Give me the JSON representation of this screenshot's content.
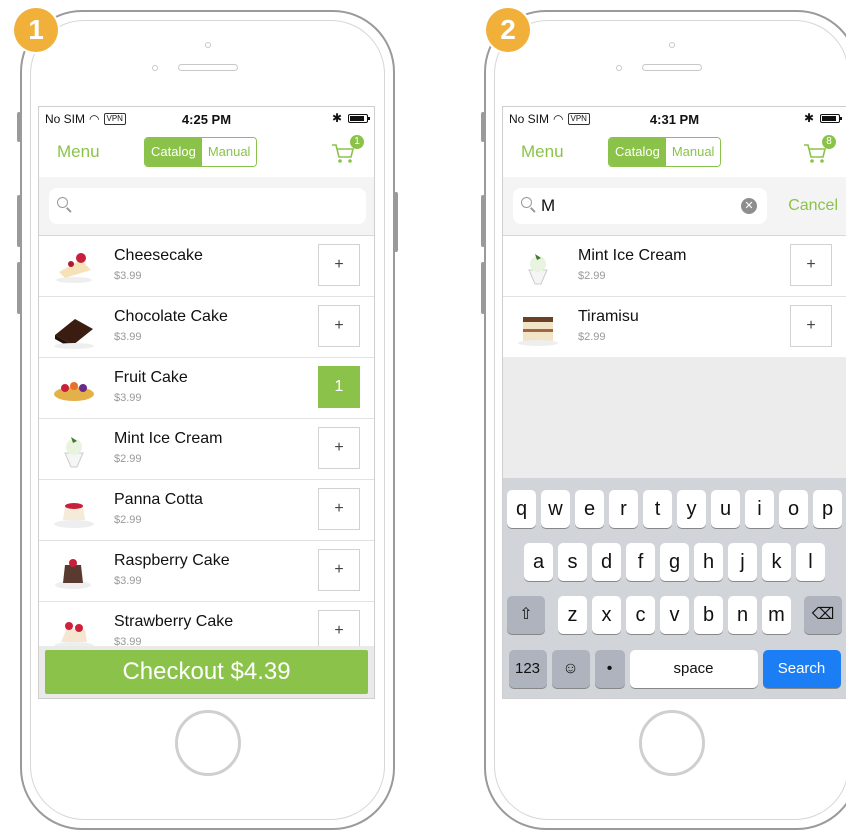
{
  "colors": {
    "accent": "#8bc34a",
    "badge": "#f0b03a",
    "key_blue": "#1b7ef4"
  },
  "phone1": {
    "step": "1",
    "status": {
      "carrier": "No SIM",
      "vpn": "VPN",
      "time": "4:25 PM"
    },
    "nav": {
      "menu": "Menu",
      "seg_catalog": "Catalog",
      "seg_manual": "Manual",
      "cart_count": "1"
    },
    "search": {
      "value": ""
    },
    "items": [
      {
        "name": "Cheesecake",
        "price": "$3.99",
        "qty": "+"
      },
      {
        "name": "Chocolate Cake",
        "price": "$3.99",
        "qty": "+"
      },
      {
        "name": "Fruit Cake",
        "price": "$3.99",
        "qty": "1"
      },
      {
        "name": "Mint Ice Cream",
        "price": "$2.99",
        "qty": "+"
      },
      {
        "name": "Panna Cotta",
        "price": "$2.99",
        "qty": "+"
      },
      {
        "name": "Raspberry Cake",
        "price": "$3.99",
        "qty": "+"
      },
      {
        "name": "Strawberry Cake",
        "price": "$3.99",
        "qty": "+"
      }
    ],
    "checkout": "Checkout $4.39"
  },
  "phone2": {
    "step": "2",
    "status": {
      "carrier": "No SIM",
      "vpn": "VPN",
      "time": "4:31 PM"
    },
    "nav": {
      "menu": "Menu",
      "seg_catalog": "Catalog",
      "seg_manual": "Manual",
      "cart_count": "8"
    },
    "search": {
      "value": "M",
      "cancel": "Cancel"
    },
    "items": [
      {
        "name": "Mint Ice Cream",
        "price": "$2.99",
        "qty": "+"
      },
      {
        "name": "Tiramisu",
        "price": "$2.99",
        "qty": "+"
      }
    ],
    "keyboard": {
      "row1": [
        "q",
        "w",
        "e",
        "r",
        "t",
        "y",
        "u",
        "i",
        "o",
        "p"
      ],
      "row2": [
        "a",
        "s",
        "d",
        "f",
        "g",
        "h",
        "j",
        "k",
        "l"
      ],
      "row3": [
        "z",
        "x",
        "c",
        "v",
        "b",
        "n",
        "m"
      ],
      "numbers": "123",
      "space": "space",
      "search": "Search"
    }
  }
}
